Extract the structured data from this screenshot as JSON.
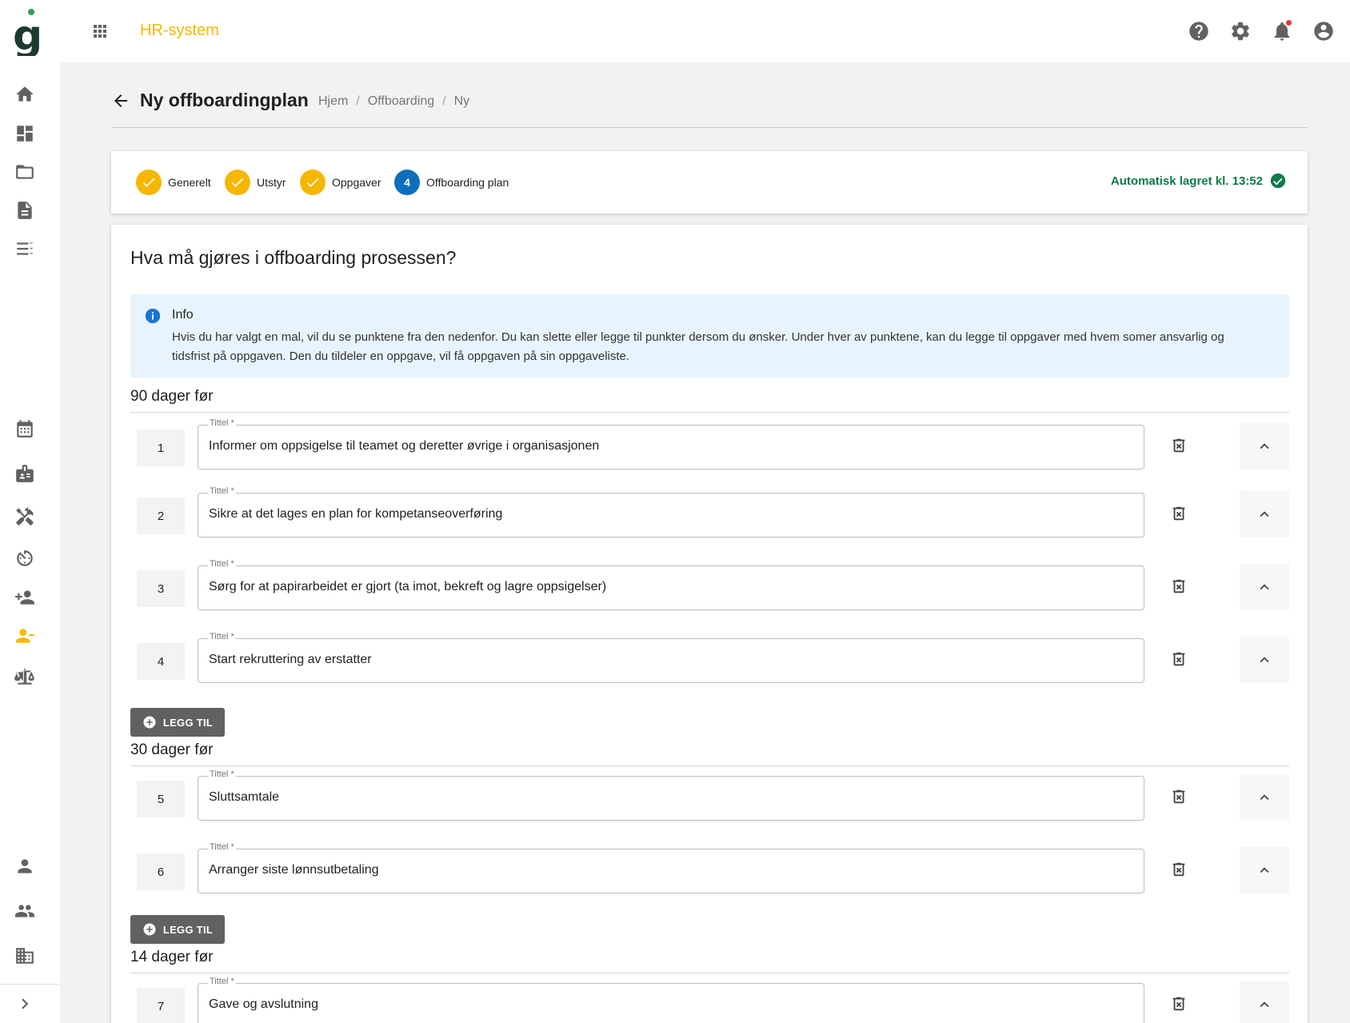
{
  "app": {
    "title": "HR-system"
  },
  "icons": {
    "logo": "app-logo",
    "apps": "apps-grid-icon",
    "top_right": [
      "help-icon",
      "settings-icon",
      "notifications-icon",
      "account-icon"
    ],
    "sidebar": [
      "home-icon",
      "dashboard-icon",
      "folder-icon",
      "document-icon",
      "checklist-icon",
      "calendar-icon",
      "badge-icon",
      "tools-icon",
      "timer-icon",
      "person-add-icon",
      "person-remove-icon",
      "scale-icon",
      "person-icon",
      "group-icon",
      "building-icon",
      "chevron-right-icon"
    ]
  },
  "colors": {
    "accent": "#f5b700",
    "step_current": "#0d6ebc",
    "success": "#0f7a4a",
    "info_bg": "#e8f4fd"
  },
  "header": {
    "title": "Ny offboardingplan",
    "breadcrumb": [
      "Hjem",
      "Offboarding",
      "Ny"
    ]
  },
  "stepper": {
    "steps": [
      {
        "label": "Generelt",
        "state": "done"
      },
      {
        "label": "Utstyr",
        "state": "done"
      },
      {
        "label": "Oppgaver",
        "state": "done"
      },
      {
        "label": "Offboarding plan",
        "state": "current",
        "number": "4"
      }
    ],
    "autosave": "Automatisk lagret kl. 13:52"
  },
  "main": {
    "question": "Hva må gjøres i offboarding prosessen?",
    "info": {
      "title": "Info",
      "text": "Hvis du har valgt en mal, vil du se punktene fra den nedenfor. Du kan slette eller legge til punkter dersom du ønsker. Under hver av punktene, kan du legge til oppgaver med hvem somer ansvarlig og tidsfrist på oppgaven. Den du tildeler en oppgave, vil få oppgaven på sin oppgaveliste."
    },
    "field_label": "Tittel *",
    "add_label": "LEGG TIL",
    "sections": [
      {
        "title": "90 dager før",
        "items": [
          {
            "num": "1",
            "title": "Informer om oppsigelse til teamet og deretter øvrige i organisasjonen"
          },
          {
            "num": "2",
            "title": "Sikre at det lages en plan for kompetanseoverføring"
          },
          {
            "num": "3",
            "title": "Sørg for at papirarbeidet er gjort (ta imot, bekreft og lagre oppsigelser)"
          },
          {
            "num": "4",
            "title": "Start rekruttering av erstatter"
          }
        ]
      },
      {
        "title": "30 dager før",
        "items": [
          {
            "num": "5",
            "title": "Sluttsamtale"
          },
          {
            "num": "6",
            "title": "Arranger siste lønnsutbetaling"
          }
        ]
      },
      {
        "title": "14 dager før",
        "items": [
          {
            "num": "7",
            "title": "Gave og avslutning"
          }
        ]
      }
    ]
  }
}
